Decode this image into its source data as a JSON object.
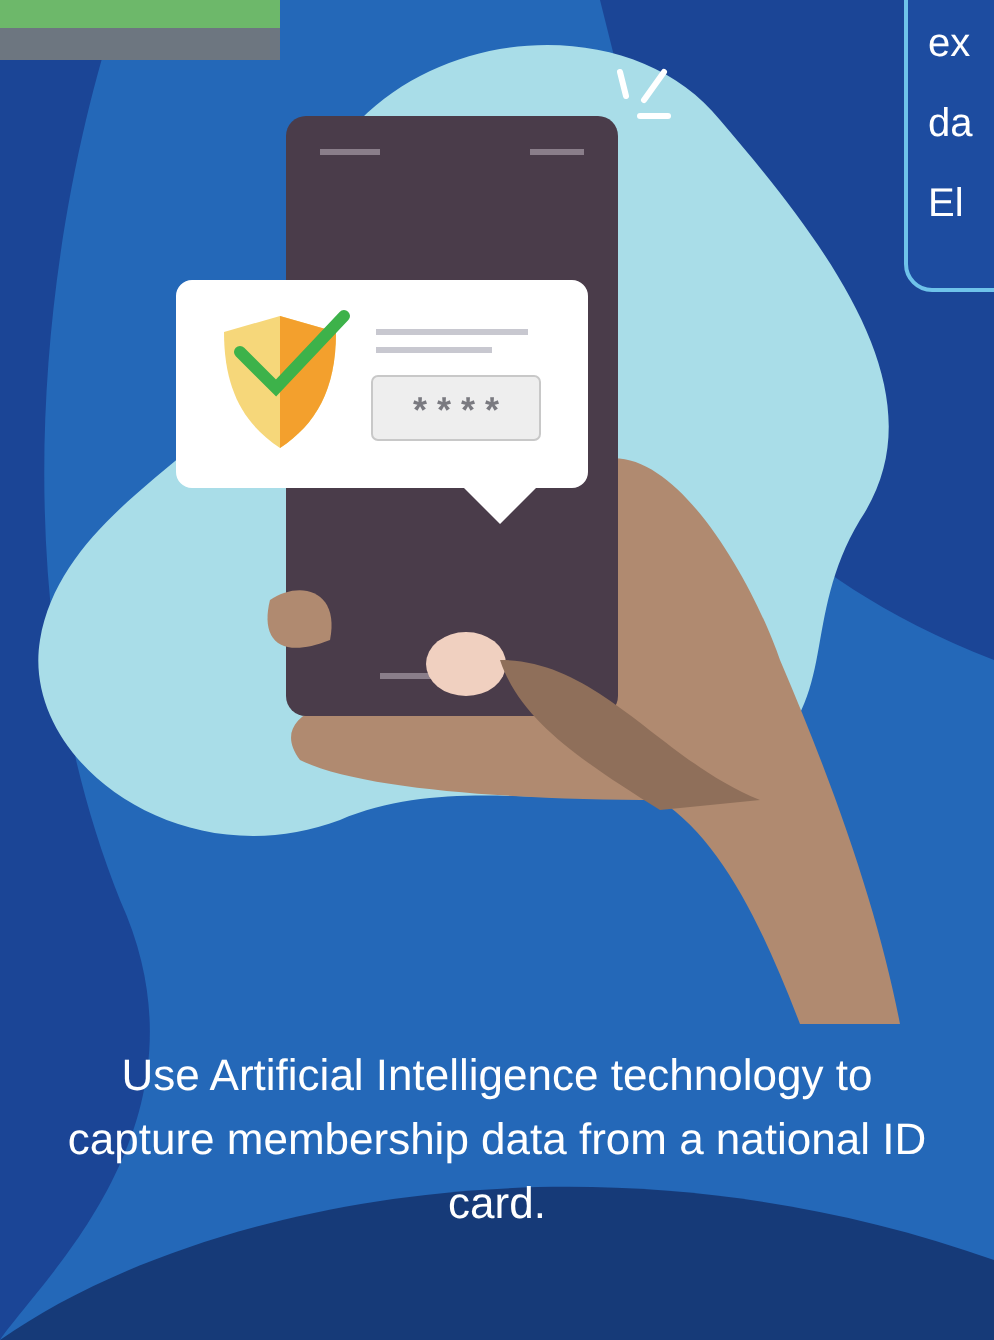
{
  "info_box": {
    "lines": [
      "ex",
      "da",
      "El"
    ]
  },
  "login_popup": {
    "password_mask": "* * * *"
  },
  "caption": "Use Artificial Intelligence technology to capture membership data from a national ID card."
}
